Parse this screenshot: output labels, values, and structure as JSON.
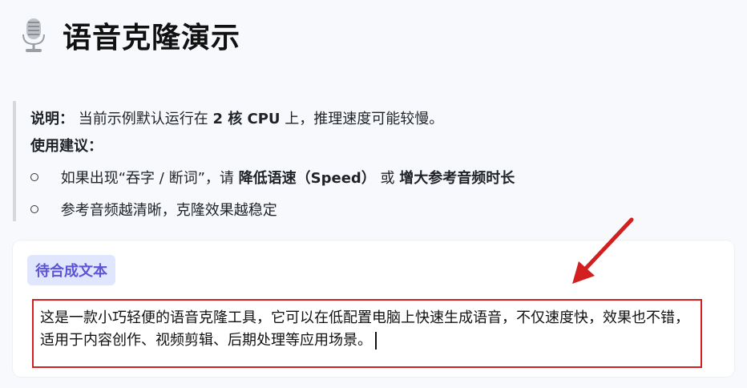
{
  "header": {
    "icon": "microphone-icon",
    "title": "语音克隆演示"
  },
  "note": {
    "label": "说明：",
    "text_before": "当前示例默认运行在",
    "bold_cores": "2 核 CPU",
    "text_after": "上，推理速度可能较慢。",
    "advice_label": "使用建议：",
    "tip1_prefix": "如果出现“吞字 / 断词”，请",
    "tip1_bold1": "降低语速（Speed）",
    "tip1_or": "或",
    "tip1_bold2": "增大参考音频时长",
    "tip2": "参考音频越清晰，克隆效果越稳定"
  },
  "synthesis": {
    "label": "待合成文本",
    "text": "这是一款小巧轻便的语音克隆工具，它可以在低配置电脑上快速生成语音，不仅速度快，效果也不错，适用于内容创作、视频剪辑、后期处理等应用场景。"
  },
  "colors": {
    "highlight_border": "#d21f1f",
    "label_bg": "#e1e6ff",
    "label_text": "#5b55d6"
  }
}
